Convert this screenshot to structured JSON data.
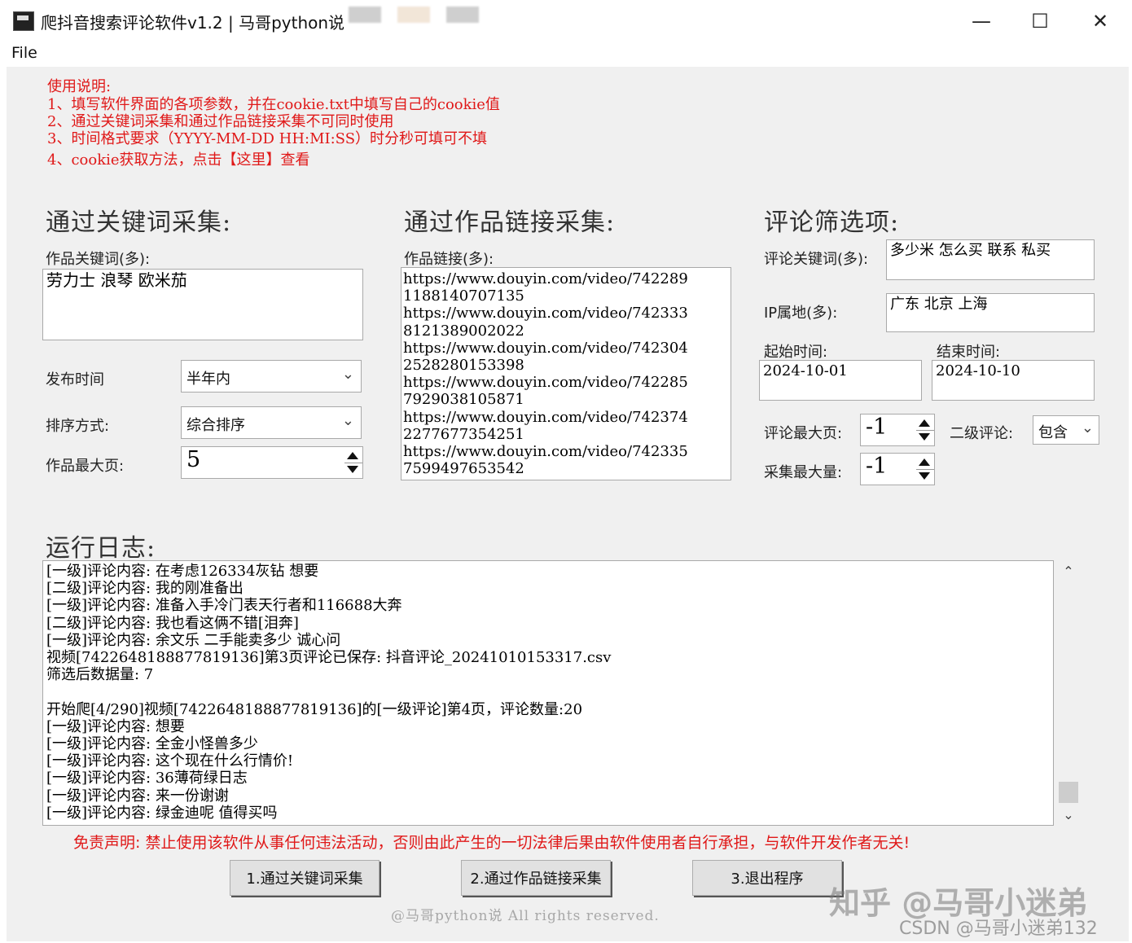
{
  "window": {
    "title": "爬抖音搜索评论软件v1.2 | 马哥python说",
    "minimize": "—",
    "maximize": "☐",
    "close": "✕"
  },
  "menu": {
    "file": "File"
  },
  "instructions": {
    "heading": "使用说明:",
    "line1": "1、填写软件界面的各项参数，并在cookie.txt中填写自己的cookie值",
    "line2": "2、通过关键词采集和通过作品链接采集不可同时使用",
    "line3": "3、时间格式要求（YYYY-MM-DD HH:MI:SS）时分秒可填可不填",
    "line4": "4、cookie获取方法，点击【这里】查看"
  },
  "keyword_section": {
    "title": "通过关键词采集:",
    "keywords_label": "作品关键词(多):",
    "keywords_value": "劳力士 浪琴 欧米茄",
    "publish_time_label": "发布时间",
    "publish_time_value": "半年内",
    "sort_label": "排序方式:",
    "sort_value": "综合排序",
    "max_pages_label": "作品最大页:",
    "max_pages_value": "5"
  },
  "link_section": {
    "title": "通过作品链接采集:",
    "links_label": "作品链接(多):",
    "links_text": "https://www.douyin.com/video/742289\n1188140707135\nhttps://www.douyin.com/video/742333\n8121389002022\nhttps://www.douyin.com/video/742304\n2528280153398\nhttps://www.douyin.com/video/742285\n7929038105871\nhttps://www.douyin.com/video/742374\n2277677354251\nhttps://www.douyin.com/video/742335\n7599497653542"
  },
  "filter_section": {
    "title": "评论筛选项:",
    "comment_keywords_label": "评论关键词(多):",
    "comment_keywords_value": "多少米 怎么买 联系 私买",
    "ip_label": "IP属地(多):",
    "ip_value": "广东 北京 上海",
    "start_time_label": "起始时间:",
    "start_time_value": "2024-10-01",
    "end_time_label": "结束时间:",
    "end_time_value": "2024-10-10",
    "max_comment_pages_label": "评论最大页:",
    "max_comment_pages_value": "-1",
    "secondary_label": "二级评论:",
    "secondary_value": "包含",
    "max_collect_label": "采集最大量:",
    "max_collect_value": "-1"
  },
  "log_section": {
    "title": "运行日志:",
    "text": "[一级]评论内容: 在考虑126334灰钻 想要\n[二级]评论内容: 我的刚准备出\n[一级]评论内容: 准备入手冷门表天行者和116688大奔\n[二级]评论内容: 我也看这俩不错[泪奔]\n[一级]评论内容: 余文乐 二手能卖多少 诚心问\n视频[7422648188877819136]第3页评论已保存: 抖音评论_20241010153317.csv\n筛选后数据量: 7\n\n开始爬[4/290]视频[7422648188877819136]的[一级评论]第4页，评论数量:20\n[一级]评论内容: 想要\n[一级]评论内容: 全金小怪兽多少\n[一级]评论内容: 这个现在什么行情价!\n[一级]评论内容: 36薄荷绿日志\n[一级]评论内容: 来一份谢谢\n[一级]评论内容: 绿金迪呢 值得买吗"
  },
  "disclaimer": "免责声明: 禁止使用该软件从事任何违法活动，否则由此产生的一切法律后果由软件使用者自行承担，与软件开发作者无关!",
  "buttons": {
    "keyword": "1.通过关键词采集",
    "link": "2.通过作品链接采集",
    "exit": "3.退出程序"
  },
  "footer": "@马哥python说 All rights reserved.",
  "watermark": {
    "zhihu": "知乎 @马哥小迷弟",
    "csdn": "CSDN @马哥小迷弟132"
  }
}
